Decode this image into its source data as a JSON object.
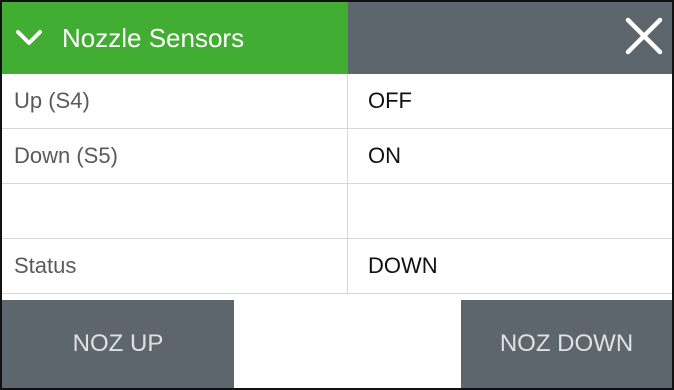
{
  "panel": {
    "title": "Nozzle Sensors",
    "chevron_icon": "chevron-down-icon",
    "close_icon": "close-icon",
    "colors": {
      "header_accent": "#41ad32",
      "header_fill": "#5e666d",
      "button_bg": "#5e666d"
    }
  },
  "sensors": [
    {
      "label": "Up (S4)",
      "value": "OFF"
    },
    {
      "label": "Down (S5)",
      "value": "ON"
    },
    {
      "label": "",
      "value": ""
    },
    {
      "label": "Status",
      "value": "DOWN"
    }
  ],
  "actions": {
    "noz_up_label": "NOZ UP",
    "noz_down_label": "NOZ DOWN"
  }
}
